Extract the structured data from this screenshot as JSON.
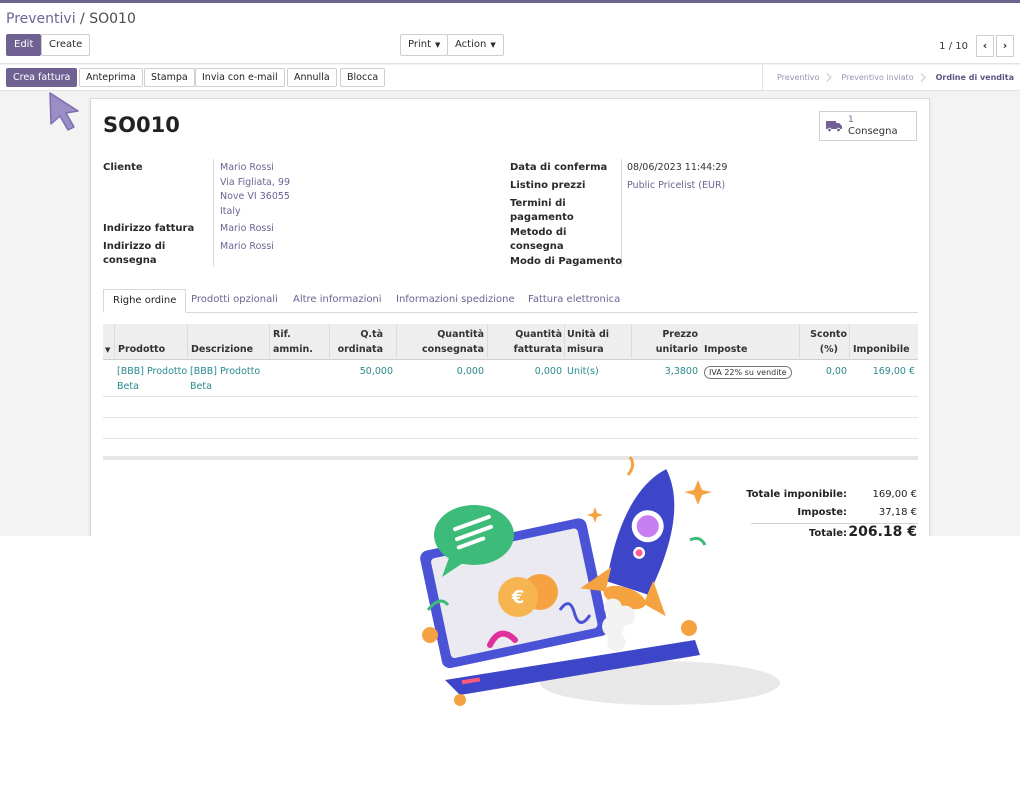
{
  "breadcrumb": {
    "parent": "Preventivi",
    "sep": "/",
    "current": "SO010"
  },
  "controls": {
    "edit": "Edit",
    "create": "Create",
    "print": "Print",
    "action": "Action",
    "pager": "1 / 10"
  },
  "statusbar": {
    "buttons": [
      "Crea fattura",
      "Anteprima",
      "Stampa",
      "Invia con e-mail",
      "Annulla",
      "Blocca"
    ],
    "stages": [
      "Preventivo",
      "Preventivo inviato",
      "Ordine di vendita"
    ]
  },
  "record": {
    "name": "SO010",
    "smart": {
      "count": "1",
      "label": "Consegna"
    },
    "cliente_label": "Cliente",
    "cliente": [
      "Mario Rossi",
      "Via Figliata, 99",
      "Nove VI 36055",
      "Italy"
    ],
    "indirizzo_fattura_label": "Indirizzo fattura",
    "indirizzo_fattura": "Mario Rossi",
    "indirizzo_consegna_label": [
      "Indirizzo di",
      "consegna"
    ],
    "indirizzo_consegna": "Mario Rossi",
    "data_conferma_label": "Data di conferma",
    "data_conferma": "08/06/2023 11:44:29",
    "listino_label": "Listino prezzi",
    "listino": "Public Pricelist (EUR)",
    "termini_label": [
      "Termini di",
      "pagamento"
    ],
    "metodo_label": [
      "Metodo di",
      "consegna"
    ],
    "modo_label": "Modo di Pagamento"
  },
  "tabs": [
    "Righe ordine",
    "Prodotti opzionali",
    "Altre informazioni",
    "Informazioni spedizione",
    "Fattura elettronica"
  ],
  "table": {
    "headers": {
      "prodotto": "Prodotto",
      "descrizione": "Descrizione",
      "rif": [
        "Rif.",
        "ammin."
      ],
      "qta": [
        "Q.tà",
        "ordinata"
      ],
      "consegnata": [
        "Quantità",
        "consegnata"
      ],
      "fatturata": [
        "Quantità",
        "fatturata"
      ],
      "unita": [
        "Unità di",
        "misura"
      ],
      "prezzo": [
        "Prezzo",
        "unitario"
      ],
      "imposte": "Imposte",
      "sconto": [
        "Sconto",
        "(%)"
      ],
      "imponibile": "Imponibile"
    },
    "rows": [
      {
        "prodotto": [
          "[BBB] Prodotto",
          "Beta"
        ],
        "descrizione": [
          "[BBB] Prodotto",
          "Beta"
        ],
        "qta": "50,000",
        "consegnata": "0,000",
        "fatturata": "0,000",
        "unita": "Unit(s)",
        "prezzo": "3,3800",
        "imposte": "IVA 22% su vendite",
        "sconto": "0,00",
        "imponibile": "169,00 €"
      }
    ]
  },
  "totals": {
    "imponibile_label": "Totale imponibile:",
    "imponibile": "169,00 €",
    "imposte_label": "Imposte:",
    "imposte": "37,18 €",
    "totale_label": "Totale:",
    "totale": "206,18 €"
  },
  "colors": {
    "primary": "#6f6293",
    "link": "#2a8a8e"
  }
}
